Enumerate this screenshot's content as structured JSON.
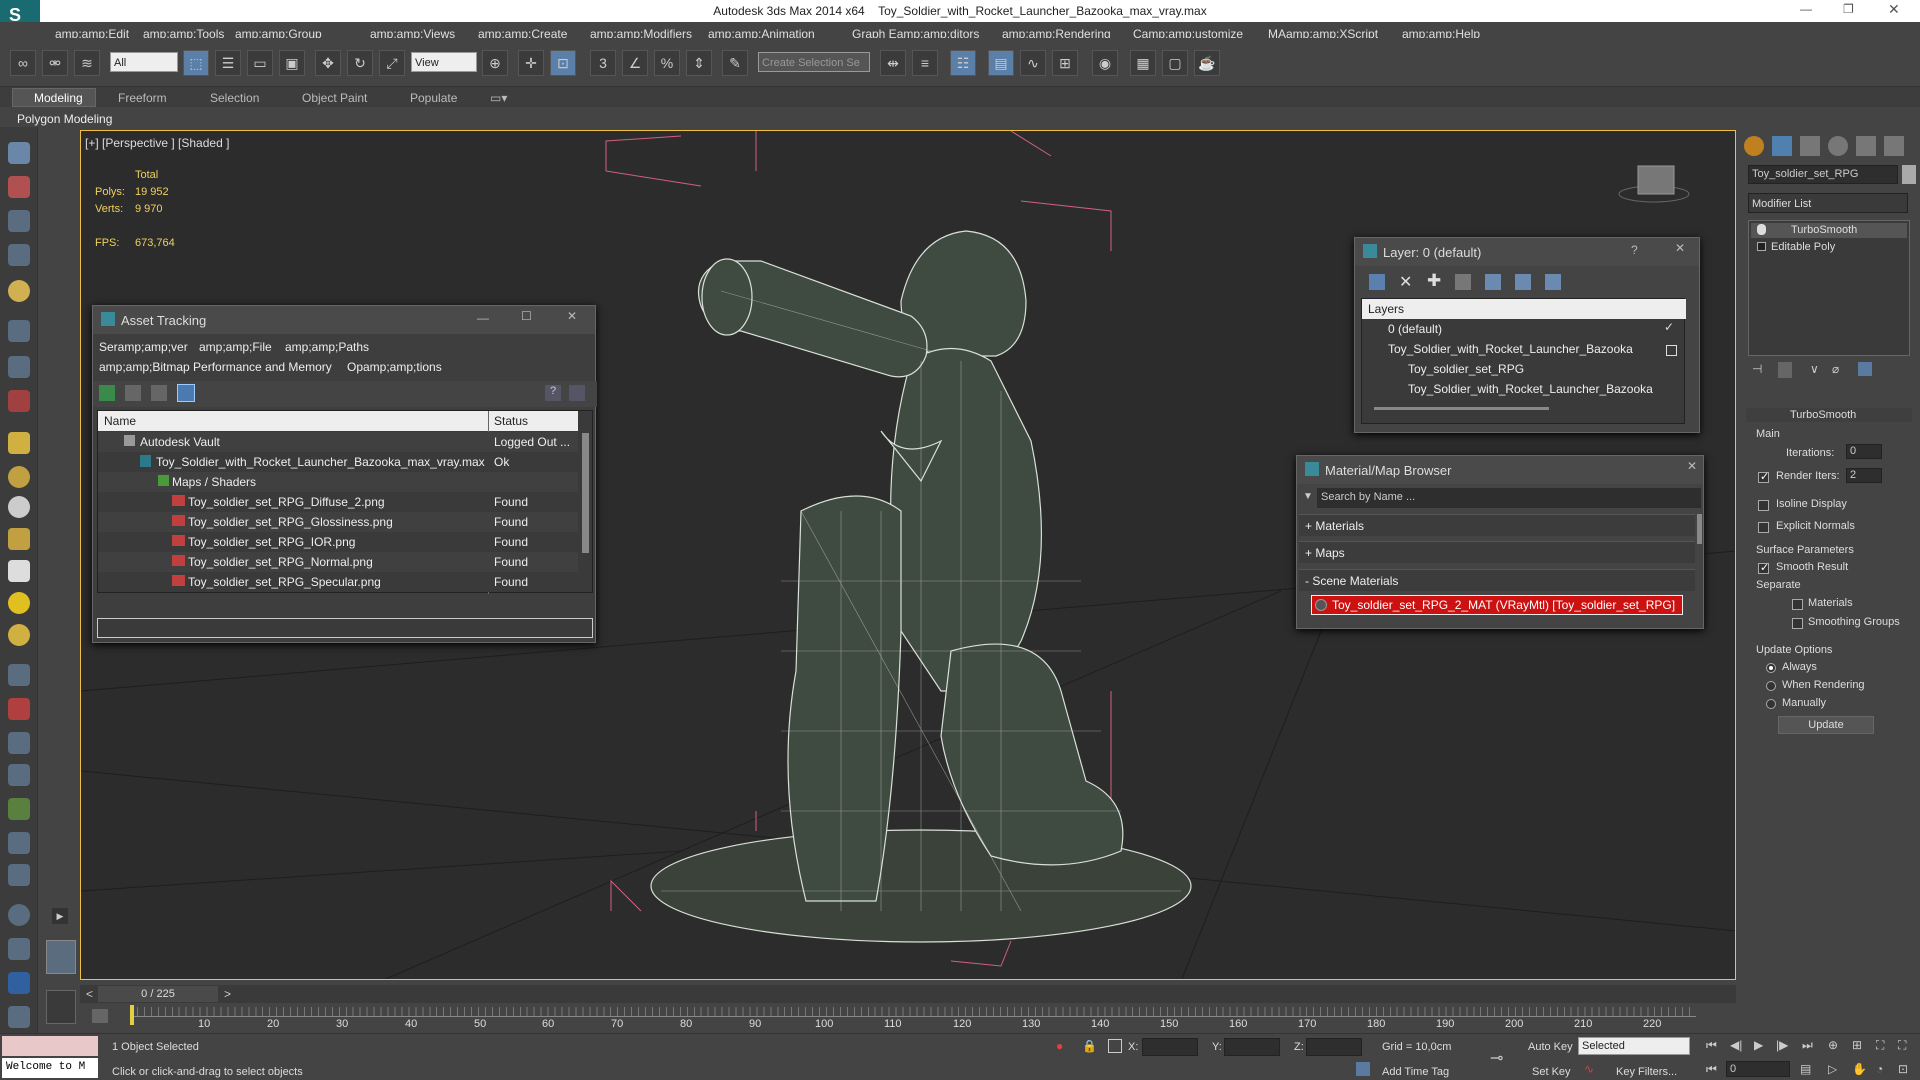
{
  "window": {
    "app": "Autodesk 3ds Max  2014 x64",
    "file": "Toy_Soldier_with_Rocket_Launcher_Bazooka_max_vray.max"
  },
  "menu": [
    "amp;amp;Edit",
    "amp;amp;Tools",
    "amp;amp;Group",
    "amp;amp;Views",
    "amp;amp;Create",
    "amp;amp;Modifiers",
    "amp;amp;Animation",
    "Graph Eamp;amp;ditors",
    "amp;amp;Rendering",
    "Camp;amp;ustomize",
    "MAamp;amp;XScript",
    "amp;amp;Help"
  ],
  "toolbar": {
    "filter": "All",
    "refcoord": "View",
    "selection_set": "Create Selection Se"
  },
  "ribbon": {
    "tabs": [
      "Modeling",
      "Freeform",
      "Selection",
      "Object Paint",
      "Populate"
    ],
    "panel": "Polygon Modeling"
  },
  "viewport": {
    "label": "[+] [Perspective ] [Shaded ]",
    "stats": {
      "total": "Total",
      "polys_label": "Polys:",
      "polys": "19 952",
      "verts_label": "Verts:",
      "verts": "9 970",
      "fps_label": "FPS:",
      "fps": "673,764"
    }
  },
  "asset_tracking": {
    "title": "Asset Tracking",
    "menu": [
      "Seramp;amp;ver",
      "amp;amp;File",
      "amp;amp;Paths",
      "amp;amp;Bitmap Performance and Memory",
      "Opamp;amp;tions"
    ],
    "columns": [
      "Name",
      "Status"
    ],
    "rows": [
      {
        "name": "Autodesk Vault",
        "status": "Logged Out ..."
      },
      {
        "name": "Toy_Soldier_with_Rocket_Launcher_Bazooka_max_vray.max",
        "status": "Ok"
      },
      {
        "name": "Maps / Shaders",
        "status": ""
      },
      {
        "name": "Toy_soldier_set_RPG_Diffuse_2.png",
        "status": "Found"
      },
      {
        "name": "Toy_soldier_set_RPG_Glossiness.png",
        "status": "Found"
      },
      {
        "name": "Toy_soldier_set_RPG_IOR.png",
        "status": "Found"
      },
      {
        "name": "Toy_soldier_set_RPG_Normal.png",
        "status": "Found"
      },
      {
        "name": "Toy_soldier_set_RPG_Specular.png",
        "status": "Found"
      }
    ]
  },
  "layer": {
    "title": "Layer: 0 (default)",
    "header": "Layers",
    "items": [
      "0 (default)",
      "Toy_Soldier_with_Rocket_Launcher_Bazooka",
      "Toy_soldier_set_RPG",
      "Toy_Soldier_with_Rocket_Launcher_Bazooka"
    ]
  },
  "material_browser": {
    "title": "Material/Map Browser",
    "search_placeholder": "Search by Name ...",
    "sections": [
      "+ Materials",
      "+ Maps",
      "- Scene Materials"
    ],
    "scene_material": "Toy_soldier_set_RPG_2_MAT (VRayMtl) [Toy_soldier_set_RPG]"
  },
  "command_panel": {
    "object_name": "Toy_soldier_set_RPG",
    "modifier_list": "Modifier List",
    "stack": [
      "TurboSmooth",
      "Editable Poly"
    ],
    "rollout": "TurboSmooth",
    "main": "Main",
    "iterations_label": "Iterations:",
    "iterations": "0",
    "render_iters_label": "Render Iters:",
    "render_iters": "2",
    "isoline": "Isoline Display",
    "explicit": "Explicit Normals",
    "surface": "Surface Parameters",
    "smooth_result": "Smooth Result",
    "separate": "Separate",
    "materials": "Materials",
    "smoothing_groups": "Smoothing Groups",
    "update_options": "Update Options",
    "always": "Always",
    "when_rendering": "When Rendering",
    "manually": "Manually",
    "update": "Update"
  },
  "timeline": {
    "frame": "0 / 225",
    "ticks": [
      "10",
      "20",
      "30",
      "40",
      "50",
      "60",
      "70",
      "80",
      "90",
      "100",
      "110",
      "120",
      "130",
      "140",
      "150",
      "160",
      "170",
      "180",
      "190",
      "200",
      "210",
      "220"
    ]
  },
  "status": {
    "maxscript": "Welcome to M",
    "selected": "1 Object Selected",
    "prompt": "Click or click-and-drag to select objects",
    "x_label": "X:",
    "y_label": "Y:",
    "z_label": "Z:",
    "grid": "Grid = 10,0cm",
    "add_time_tag": "Add Time Tag",
    "auto_key": "Auto Key",
    "set_key": "Set Key",
    "selected_dd": "Selected",
    "key_filters": "Key Filters...",
    "frame": "0"
  }
}
